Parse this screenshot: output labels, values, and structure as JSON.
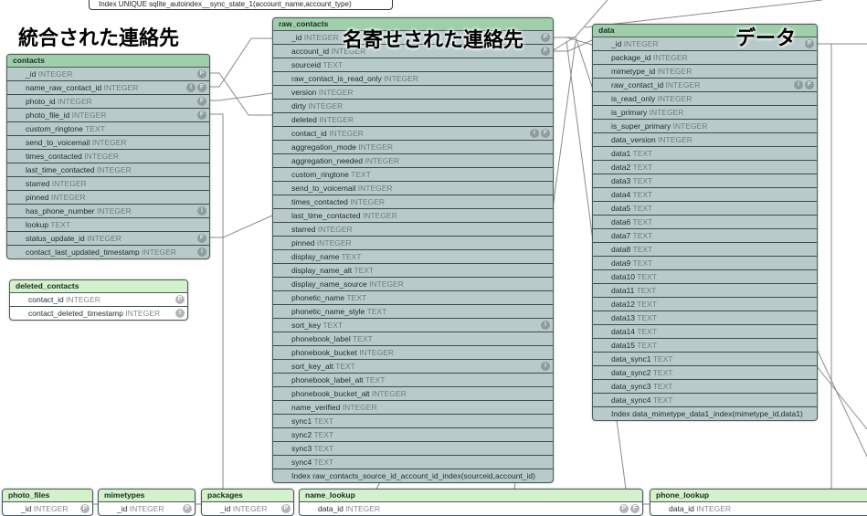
{
  "top_index": "Index UNIQUE sqlite_autoindex__sync_state_1(account_name,account_type)",
  "labels": {
    "contacts": "統合された連絡先",
    "raw_contacts": "名寄せされた連絡先",
    "data": "データ"
  },
  "colors": {
    "header_green": "#9fcfa9",
    "header_light_green": "#d3f1cb",
    "row_bg": "#b8cbca"
  },
  "tables": [
    {
      "key": "contacts",
      "title": "contacts",
      "columns": [
        {
          "name": "_id",
          "type": "INTEGER",
          "badges": [
            "P"
          ]
        },
        {
          "name": "name_raw_contact_id",
          "type": "INTEGER",
          "badges": [
            "I",
            "F"
          ]
        },
        {
          "name": "photo_id",
          "type": "INTEGER",
          "badges": [
            "F"
          ]
        },
        {
          "name": "photo_file_id",
          "type": "INTEGER",
          "badges": [
            "F"
          ]
        },
        {
          "name": "custom_ringtone",
          "type": "TEXT",
          "badges": []
        },
        {
          "name": "send_to_voicemail",
          "type": "INTEGER",
          "badges": []
        },
        {
          "name": "times_contacted",
          "type": "INTEGER",
          "badges": []
        },
        {
          "name": "last_time_contacted",
          "type": "INTEGER",
          "badges": []
        },
        {
          "name": "starred",
          "type": "INTEGER",
          "badges": []
        },
        {
          "name": "pinned",
          "type": "INTEGER",
          "badges": []
        },
        {
          "name": "has_phone_number",
          "type": "INTEGER",
          "badges": [
            "I"
          ]
        },
        {
          "name": "lookup",
          "type": "TEXT",
          "badges": []
        },
        {
          "name": "status_update_id",
          "type": "INTEGER",
          "badges": [
            "F"
          ]
        },
        {
          "name": "contact_last_updated_timestamp",
          "type": "INTEGER",
          "badges": [
            "I"
          ]
        }
      ]
    },
    {
      "key": "deleted_contacts",
      "title": "deleted_contacts",
      "columns": [
        {
          "name": "contact_id",
          "type": "INTEGER",
          "badges": [
            "P"
          ]
        },
        {
          "name": "contact_deleted_timestamp",
          "type": "INTEGER",
          "badges": [
            "I"
          ]
        }
      ]
    },
    {
      "key": "raw_contacts",
      "title": "raw_contacts",
      "columns": [
        {
          "name": "_id",
          "type": "INTEGER",
          "badges": [
            "P"
          ]
        },
        {
          "name": "account_id",
          "type": "INTEGER",
          "badges": [
            "F"
          ]
        },
        {
          "name": "sourceid",
          "type": "TEXT",
          "badges": []
        },
        {
          "name": "raw_contact_is_read_only",
          "type": "INTEGER",
          "badges": []
        },
        {
          "name": "version",
          "type": "INTEGER",
          "badges": []
        },
        {
          "name": "dirty",
          "type": "INTEGER",
          "badges": []
        },
        {
          "name": "deleted",
          "type": "INTEGER",
          "badges": []
        },
        {
          "name": "contact_id",
          "type": "INTEGER",
          "badges": [
            "I",
            "F"
          ]
        },
        {
          "name": "aggregation_mode",
          "type": "INTEGER",
          "badges": []
        },
        {
          "name": "aggregation_needed",
          "type": "INTEGER",
          "badges": []
        },
        {
          "name": "custom_ringtone",
          "type": "TEXT",
          "badges": []
        },
        {
          "name": "send_to_voicemail",
          "type": "INTEGER",
          "badges": []
        },
        {
          "name": "times_contacted",
          "type": "INTEGER",
          "badges": []
        },
        {
          "name": "last_time_contacted",
          "type": "INTEGER",
          "badges": []
        },
        {
          "name": "starred",
          "type": "INTEGER",
          "badges": []
        },
        {
          "name": "pinned",
          "type": "INTEGER",
          "badges": []
        },
        {
          "name": "display_name",
          "type": "TEXT",
          "badges": []
        },
        {
          "name": "display_name_alt",
          "type": "TEXT",
          "badges": []
        },
        {
          "name": "display_name_source",
          "type": "INTEGER",
          "badges": []
        },
        {
          "name": "phonetic_name",
          "type": "TEXT",
          "badges": []
        },
        {
          "name": "phonetic_name_style",
          "type": "TEXT",
          "badges": []
        },
        {
          "name": "sort_key",
          "type": "TEXT",
          "badges": [
            "I"
          ]
        },
        {
          "name": "phonebook_label",
          "type": "TEXT",
          "badges": []
        },
        {
          "name": "phonebook_bucket",
          "type": "INTEGER",
          "badges": []
        },
        {
          "name": "sort_key_alt",
          "type": "TEXT",
          "badges": [
            "I"
          ]
        },
        {
          "name": "phonebook_label_alt",
          "type": "TEXT",
          "badges": []
        },
        {
          "name": "phonebook_bucket_alt",
          "type": "INTEGER",
          "badges": []
        },
        {
          "name": "name_verified",
          "type": "INTEGER",
          "badges": []
        },
        {
          "name": "sync1",
          "type": "TEXT",
          "badges": []
        },
        {
          "name": "sync2",
          "type": "TEXT",
          "badges": []
        },
        {
          "name": "sync3",
          "type": "TEXT",
          "badges": []
        },
        {
          "name": "sync4",
          "type": "TEXT",
          "badges": []
        }
      ],
      "index": "Index raw_contacts_source_id_account_id_index(sourceid,account_id)"
    },
    {
      "key": "data",
      "title": "data",
      "columns": [
        {
          "name": "_id",
          "type": "INTEGER",
          "badges": [
            "P"
          ]
        },
        {
          "name": "package_id",
          "type": "INTEGER",
          "badges": []
        },
        {
          "name": "mimetype_id",
          "type": "INTEGER",
          "badges": []
        },
        {
          "name": "raw_contact_id",
          "type": "INTEGER",
          "badges": [
            "I",
            "F"
          ]
        },
        {
          "name": "is_read_only",
          "type": "INTEGER",
          "badges": []
        },
        {
          "name": "is_primary",
          "type": "INTEGER",
          "badges": []
        },
        {
          "name": "is_super_primary",
          "type": "INTEGER",
          "badges": []
        },
        {
          "name": "data_version",
          "type": "INTEGER",
          "badges": []
        },
        {
          "name": "data1",
          "type": "TEXT",
          "badges": []
        },
        {
          "name": "data2",
          "type": "TEXT",
          "badges": []
        },
        {
          "name": "data3",
          "type": "TEXT",
          "badges": []
        },
        {
          "name": "data4",
          "type": "TEXT",
          "badges": []
        },
        {
          "name": "data5",
          "type": "TEXT",
          "badges": []
        },
        {
          "name": "data6",
          "type": "TEXT",
          "badges": []
        },
        {
          "name": "data7",
          "type": "TEXT",
          "badges": []
        },
        {
          "name": "data8",
          "type": "TEXT",
          "badges": []
        },
        {
          "name": "data9",
          "type": "TEXT",
          "badges": []
        },
        {
          "name": "data10",
          "type": "TEXT",
          "badges": []
        },
        {
          "name": "data11",
          "type": "TEXT",
          "badges": []
        },
        {
          "name": "data12",
          "type": "TEXT",
          "badges": []
        },
        {
          "name": "data13",
          "type": "TEXT",
          "badges": []
        },
        {
          "name": "data14",
          "type": "TEXT",
          "badges": []
        },
        {
          "name": "data15",
          "type": "TEXT",
          "badges": []
        },
        {
          "name": "data_sync1",
          "type": "TEXT",
          "badges": []
        },
        {
          "name": "data_sync2",
          "type": "TEXT",
          "badges": []
        },
        {
          "name": "data_sync3",
          "type": "TEXT",
          "badges": []
        },
        {
          "name": "data_sync4",
          "type": "TEXT",
          "badges": []
        }
      ],
      "index": "Index data_mimetype_data1_index(mimetype_id,data1)"
    },
    {
      "key": "photo_files",
      "title": "photo_files",
      "columns": [
        {
          "name": "_id",
          "type": "INTEGER",
          "badges": [
            "P"
          ]
        }
      ]
    },
    {
      "key": "mimetypes",
      "title": "mimetypes",
      "columns": [
        {
          "name": "_id",
          "type": "INTEGER",
          "badges": [
            "P"
          ]
        }
      ]
    },
    {
      "key": "packages",
      "title": "packages",
      "columns": [
        {
          "name": "_id",
          "type": "INTEGER",
          "badges": [
            "P"
          ]
        }
      ]
    },
    {
      "key": "name_lookup",
      "title": "name_lookup",
      "columns": [
        {
          "name": "data_id",
          "type": "INTEGER",
          "badges": [
            "P",
            "F"
          ]
        }
      ]
    },
    {
      "key": "phone_lookup",
      "title": "phone_lookup",
      "columns": [
        {
          "name": "data_id",
          "type": "INTEGER",
          "badges": []
        }
      ]
    }
  ]
}
